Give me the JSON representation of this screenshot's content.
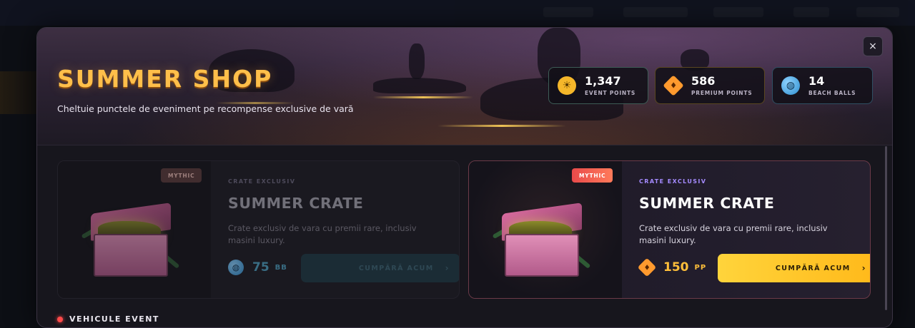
{
  "shop": {
    "title": "SUMMER SHOP",
    "subtitle": "Cheltuie punctele de eveniment pe recompense exclusive de vară",
    "close_icon": "×"
  },
  "stats": [
    {
      "value": "1,347",
      "label": "EVENT POINTS",
      "icon": "sun-icon",
      "color": "#f5b72a"
    },
    {
      "value": "586",
      "label": "PREMIUM POINTS",
      "icon": "gem-icon",
      "color": "#ff9a2e"
    },
    {
      "value": "14",
      "label": "BEACH BALLS",
      "icon": "beach-ball-icon",
      "color": "#3fa7e0"
    }
  ],
  "cards": [
    {
      "badge": "MYTHIC",
      "tag": "CRATE EXCLUSIV",
      "title": "SUMMER CRATE",
      "description": "Crate exclusiv de vara cu premii rare, inclusiv masini luxury.",
      "price": "75",
      "currency": "BB",
      "currency_icon": "beach-ball-icon",
      "button": "CUMPĂRĂ ACUM",
      "button_arrow": "›",
      "state": "disabled"
    },
    {
      "badge": "MYTHIC",
      "tag": "CRATE EXCLUSIV",
      "title": "SUMMER CRATE",
      "description": "Crate exclusiv de vara cu premii rare, inclusiv masini luxury.",
      "price": "150",
      "currency": "PP",
      "currency_icon": "gem-icon",
      "button": "CUMPĂRĂ ACUM",
      "button_arrow": "›",
      "state": "active"
    }
  ],
  "next_section": {
    "title": "VEHICULE EVENT"
  },
  "colors": {
    "accent": "#ffbf4a",
    "buy_active": "#ffd43b",
    "mythic": "#e84a4a"
  }
}
